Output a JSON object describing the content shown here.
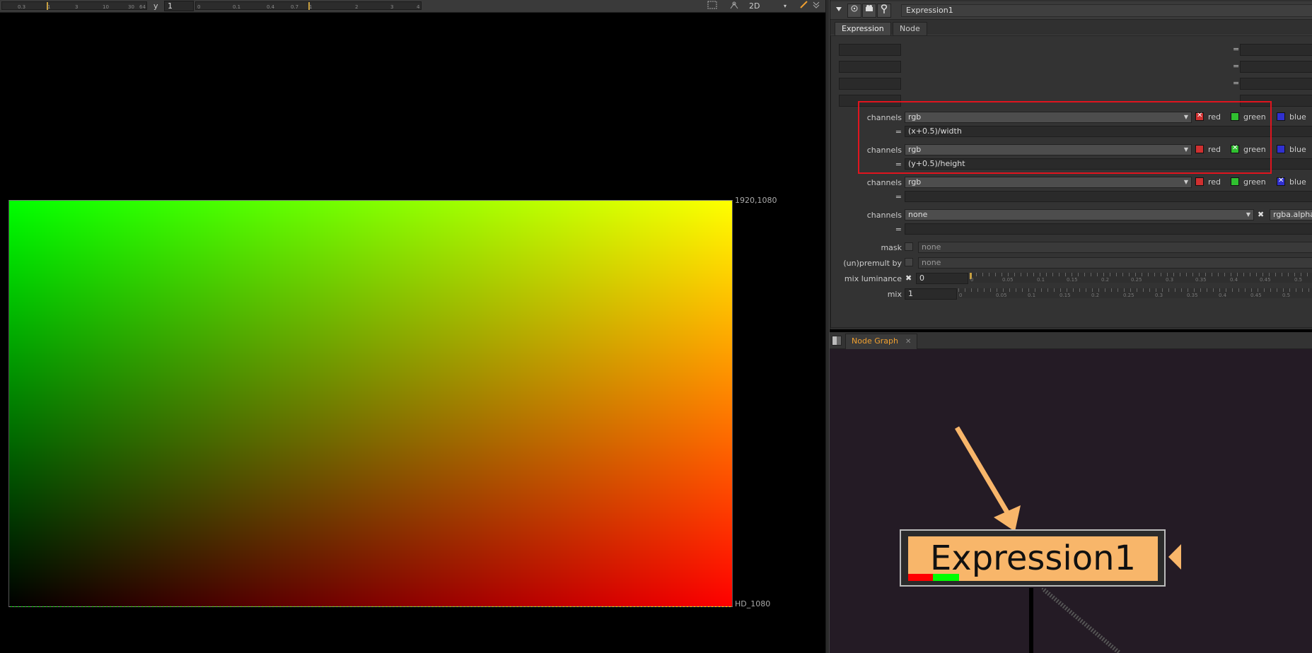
{
  "viewer": {
    "ruler_left_ticks": [
      "0.3",
      "1",
      "3",
      "10",
      "30",
      "64"
    ],
    "y_label": "y",
    "y_value": "1",
    "ruler_right_ticks": [
      "0",
      "0.1",
      "0.4",
      "0.7",
      "1",
      "2",
      "3",
      "4"
    ],
    "view_mode": "2D",
    "dropdown_arrow": "▾",
    "format_top_right": "1920,1080",
    "format_bottom_right": "HD_1080"
  },
  "properties": {
    "node_name": "Expression1",
    "tabs": [
      {
        "label": "Expression",
        "active": true
      },
      {
        "label": "Node",
        "active": false
      }
    ],
    "temp_eq": "=",
    "rows": [
      {
        "channels_label": "channels",
        "channels_value": "rgb",
        "red": "red",
        "green": "green",
        "blue": "blue",
        "eq_label": "=",
        "expr": "(x+0.5)/width"
      },
      {
        "channels_label": "channels",
        "channels_value": "rgb",
        "red": "red",
        "green": "green",
        "blue": "blue",
        "eq_label": "=",
        "expr": "(y+0.5)/height"
      },
      {
        "channels_label": "channels",
        "channels_value": "rgb",
        "red": "red",
        "green": "green",
        "blue": "blue",
        "eq_label": "=",
        "expr": ""
      },
      {
        "channels_label": "channels",
        "channels_value": "none",
        "alpha_value": "rgba.alpha",
        "eq_label": "=",
        "expr": ""
      }
    ],
    "mask_label": "mask",
    "mask_value": "none",
    "unpremult_label": "(un)premult by",
    "unpremult_value": "none",
    "mix_luminance_label": "mix luminance",
    "mix_luminance_value": "0",
    "mix_luminance_ticks": [
      "0",
      "0.05",
      "0.1",
      "0.15",
      "0.2",
      "0.25",
      "0.3",
      "0.35",
      "0.4",
      "0.45",
      "0.5"
    ],
    "mix_label": "mix",
    "mix_value": "1",
    "mix_ticks": [
      "0",
      "0.05",
      "0.1",
      "0.15",
      "0.2",
      "0.25",
      "0.3",
      "0.35",
      "0.4",
      "0.45",
      "0.5"
    ]
  },
  "node_graph": {
    "tab_label": "Node Graph",
    "close_glyph": "✕",
    "node_label": "Expression1"
  },
  "colors": {
    "accent_orange": "#f0a030",
    "node_fill": "#f8b66a",
    "highlight_red": "#e0141e",
    "graph_bg": "#241b25"
  }
}
